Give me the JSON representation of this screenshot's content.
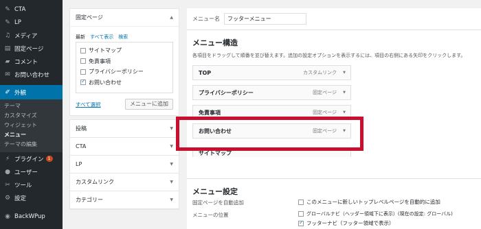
{
  "sidebar": {
    "items": [
      {
        "label": "CTA",
        "icon": "pin-icon"
      },
      {
        "label": "LP",
        "icon": "pin-icon"
      },
      {
        "label": "メディア",
        "icon": "media-icon"
      },
      {
        "label": "固定ページ",
        "icon": "page-icon"
      },
      {
        "label": "コメント",
        "icon": "comment-icon"
      },
      {
        "label": "お問い合わせ",
        "icon": "mail-icon"
      }
    ],
    "active": {
      "label": "外観",
      "icon": "brush-icon"
    },
    "submenu": [
      "テーマ",
      "カスタマイズ",
      "ウィジェット",
      "メニュー",
      "テーマの編集"
    ],
    "items_after": [
      {
        "label": "プラグイン",
        "icon": "plugin-icon",
        "badge": "1"
      },
      {
        "label": "ユーザー",
        "icon": "user-icon"
      },
      {
        "label": "ツール",
        "icon": "wrench-icon"
      },
      {
        "label": "設定",
        "icon": "settings-icon"
      }
    ],
    "backwpup": "BackWPup"
  },
  "left_panel": {
    "title": "固定ページ",
    "tabs": [
      "最新",
      "すべて表示",
      "検索"
    ],
    "pages": [
      {
        "label": "サイトマップ",
        "checked": false
      },
      {
        "label": "免責事項",
        "checked": false
      },
      {
        "label": "プライバシーポリシー",
        "checked": false
      },
      {
        "label": "お問い合わせ",
        "checked": true
      }
    ],
    "select_all": "すべて選択",
    "add_button": "メニューに追加",
    "accordions": [
      "投稿",
      "CTA",
      "LP",
      "カスタムリンク",
      "カテゴリー"
    ]
  },
  "right_panel": {
    "name_label": "メニュー名",
    "name_value": "フッターメニュー",
    "structure_title": "メニュー構造",
    "structure_desc": "各項目をドラッグして順番を並び替えます。追加の設定オプションを表示するには、項目の右側にある矢印をクリックします。",
    "menu_items": [
      {
        "label": "TOP",
        "type": "カスタムリンク"
      },
      {
        "label": "プライバシーポリシー",
        "type": "固定ページ"
      },
      {
        "label": "免責事項",
        "type": "固定ページ"
      },
      {
        "label": "お問い合わせ",
        "type": "固定ページ"
      },
      {
        "label": "サイトマップ",
        "type": ""
      }
    ],
    "settings_title": "メニュー設定",
    "auto_add_label": "固定ページを自動追加",
    "auto_add_option": "このメニューに新しいトップレベルページを自動的に追加",
    "location_label": "メニューの位置",
    "locations": [
      {
        "label": "グローバルナビ（ヘッダー領域下に表示）(現在の設定: グローバル)",
        "checked": false
      },
      {
        "label": "フッターナビ（フッター領域で表示）",
        "checked": true
      }
    ]
  },
  "colors": {
    "highlight": "#c8102e",
    "sidebar": "#23282d",
    "active": "#0073aa"
  }
}
